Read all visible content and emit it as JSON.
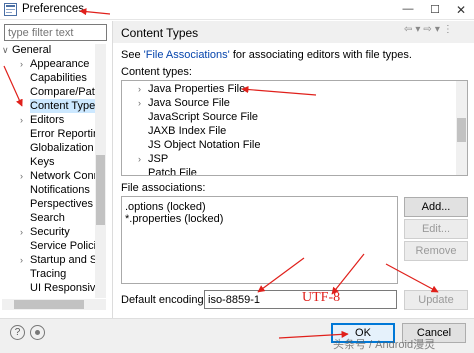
{
  "window": {
    "title": "Preferences",
    "controls": [
      "minimize",
      "maximize",
      "close"
    ]
  },
  "sidebar": {
    "filter_placeholder": "type filter text",
    "items": [
      {
        "label": "General",
        "expanded": true
      },
      {
        "label": "Appearance",
        "expanded": false
      },
      {
        "label": "Capabilities"
      },
      {
        "label": "Compare/Patch"
      },
      {
        "label": "Content Types",
        "selected": true
      },
      {
        "label": "Editors",
        "expanded": false
      },
      {
        "label": "Error Reporting"
      },
      {
        "label": "Globalization"
      },
      {
        "label": "Keys"
      },
      {
        "label": "Network Connections",
        "expanded": false
      },
      {
        "label": "Notifications"
      },
      {
        "label": "Perspectives"
      },
      {
        "label": "Search"
      },
      {
        "label": "Security",
        "expanded": false
      },
      {
        "label": "Service Policies"
      },
      {
        "label": "Startup and Shutdown",
        "expanded": false
      },
      {
        "label": "Tracing"
      },
      {
        "label": "UI Responsiveness"
      }
    ]
  },
  "main": {
    "title": "Content Types",
    "intro_prefix": "See ",
    "intro_link": "'File Associations'",
    "intro_suffix": " for associating editors with file types.",
    "content_types_label": "Content types:",
    "content_types": [
      {
        "label": "Java Properties File",
        "expandable": true
      },
      {
        "label": "Java Source File",
        "expandable": true
      },
      {
        "label": "JavaScript Source File"
      },
      {
        "label": "JAXB Index File"
      },
      {
        "label": "JS Object Notation File"
      },
      {
        "label": "JSP",
        "expandable": true
      },
      {
        "label": "Patch File"
      }
    ],
    "file_associations_label": "File associations:",
    "file_associations": [
      ".options (locked)",
      "*.properties (locked)"
    ],
    "buttons": {
      "add": "Add...",
      "edit": "Edit...",
      "remove": "Remove",
      "update": "Update"
    },
    "default_encoding_label": "Default encoding:",
    "default_encoding_value": "iso-8859-1",
    "handwritten_note": "UTF-8"
  },
  "footer": {
    "ok": "OK",
    "cancel": "Cancel",
    "watermark": "头条号 / Android漫灵"
  },
  "colors": {
    "annotation_red": "#e0201b",
    "selection": "#cce8ff",
    "link": "#0645ad",
    "default_button_border": "#0078d7"
  }
}
